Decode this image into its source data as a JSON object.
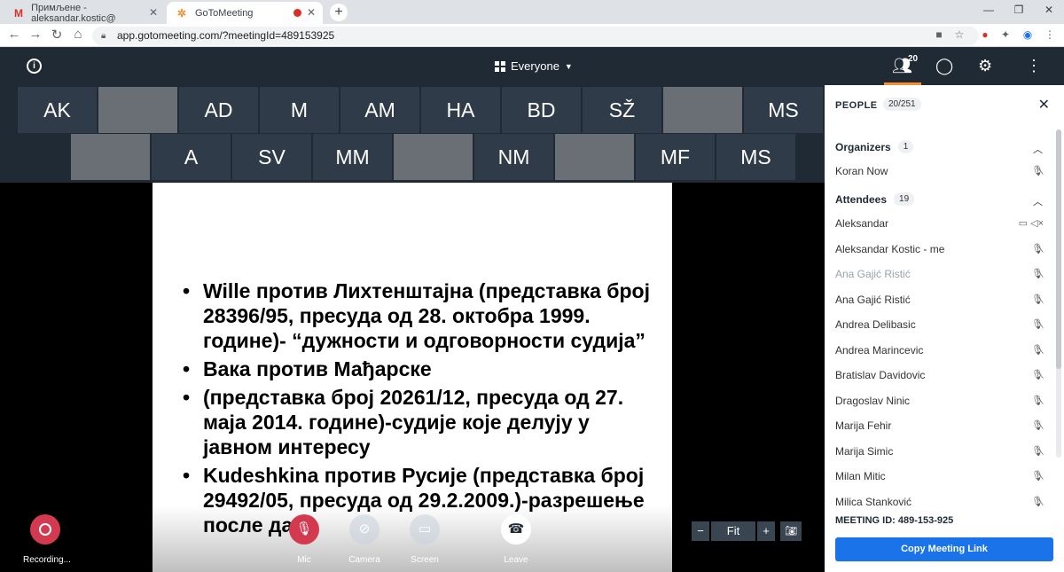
{
  "browser": {
    "tabs": [
      {
        "title": "Примљене - aleksandar.kostic@",
        "icon": "gmail-icon",
        "active": false
      },
      {
        "title": "GoToMeeting",
        "icon": "gotomeeting-icon",
        "active": true
      }
    ],
    "url": "app.gotomeeting.com/?meetingId=489153925"
  },
  "header": {
    "view_label": "Everyone",
    "people_count": "20"
  },
  "tiles_row1": [
    {
      "label": "AK",
      "video": false
    },
    {
      "label": "",
      "video": true
    },
    {
      "label": "AD",
      "video": false
    },
    {
      "label": "M",
      "video": false
    },
    {
      "label": "AM",
      "video": false
    },
    {
      "label": "HA",
      "video": false
    },
    {
      "label": "BD",
      "video": false
    },
    {
      "label": "SŽ",
      "video": false
    },
    {
      "label": "",
      "video": true
    },
    {
      "label": "MS",
      "video": false
    }
  ],
  "tiles_row2": [
    {
      "label": "",
      "video": true
    },
    {
      "label": "A",
      "video": false
    },
    {
      "label": "SV",
      "video": false
    },
    {
      "label": "MM",
      "video": false
    },
    {
      "label": "",
      "video": true
    },
    {
      "label": "NM",
      "video": false
    },
    {
      "label": "",
      "video": true
    },
    {
      "label": "MF",
      "video": false
    },
    {
      "label": "MS",
      "video": false
    }
  ],
  "slide": {
    "bullets": [
      "Wille против Лихтенштајна (представка број 28396/95, пресуда од 28. октобра 1999. године)- “дужности и одговорности судија”",
      "Вака против Мађарске",
      "(представка број 20261/12, пресуда од 27. маја 2014. године)-судије које делују у јавном интересу",
      "Kudeshkina против Русије (представка број 29492/05, пресуда од 29.2.2009.)-разрешење после дате"
    ]
  },
  "controls": {
    "recording_label": "Recording...",
    "mic_label": "Mic",
    "camera_label": "Camera",
    "screen_label": "Screen",
    "leave_label": "Leave",
    "zoom_minus": "−",
    "zoom_fit": "Fit",
    "zoom_plus": "+"
  },
  "people_panel": {
    "title": "PEOPLE",
    "count": "20/251",
    "organizers_label": "Organizers",
    "organizers_count": "1",
    "organizers": [
      {
        "name": "Koran Now",
        "dim": false
      }
    ],
    "attendees_label": "Attendees",
    "attendees_count": "19",
    "attendees": [
      {
        "name": "Aleksandar",
        "dim": false,
        "screen": true
      },
      {
        "name": "Aleksandar Kostic  - me",
        "dim": false,
        "screen": false
      },
      {
        "name": "Ana Gajić Ristić",
        "dim": true,
        "screen": false
      },
      {
        "name": "Ana Gajić Ristić",
        "dim": false,
        "screen": false
      },
      {
        "name": "Andrea Delibasic",
        "dim": false,
        "screen": false
      },
      {
        "name": "Andrea Marincevic",
        "dim": false,
        "screen": false
      },
      {
        "name": "Bratislav Davidovic",
        "dim": false,
        "screen": false
      },
      {
        "name": "Dragoslav Ninic",
        "dim": false,
        "screen": false
      },
      {
        "name": "Marija Fehir",
        "dim": false,
        "screen": false
      },
      {
        "name": "Marija Simic",
        "dim": false,
        "screen": false
      },
      {
        "name": "Milan Mitic",
        "dim": false,
        "screen": false
      },
      {
        "name": "Milica Stanković",
        "dim": false,
        "screen": false
      }
    ],
    "meeting_id": "MEETING ID: 489-153-925",
    "copy_link_label": "Copy Meeting Link"
  }
}
